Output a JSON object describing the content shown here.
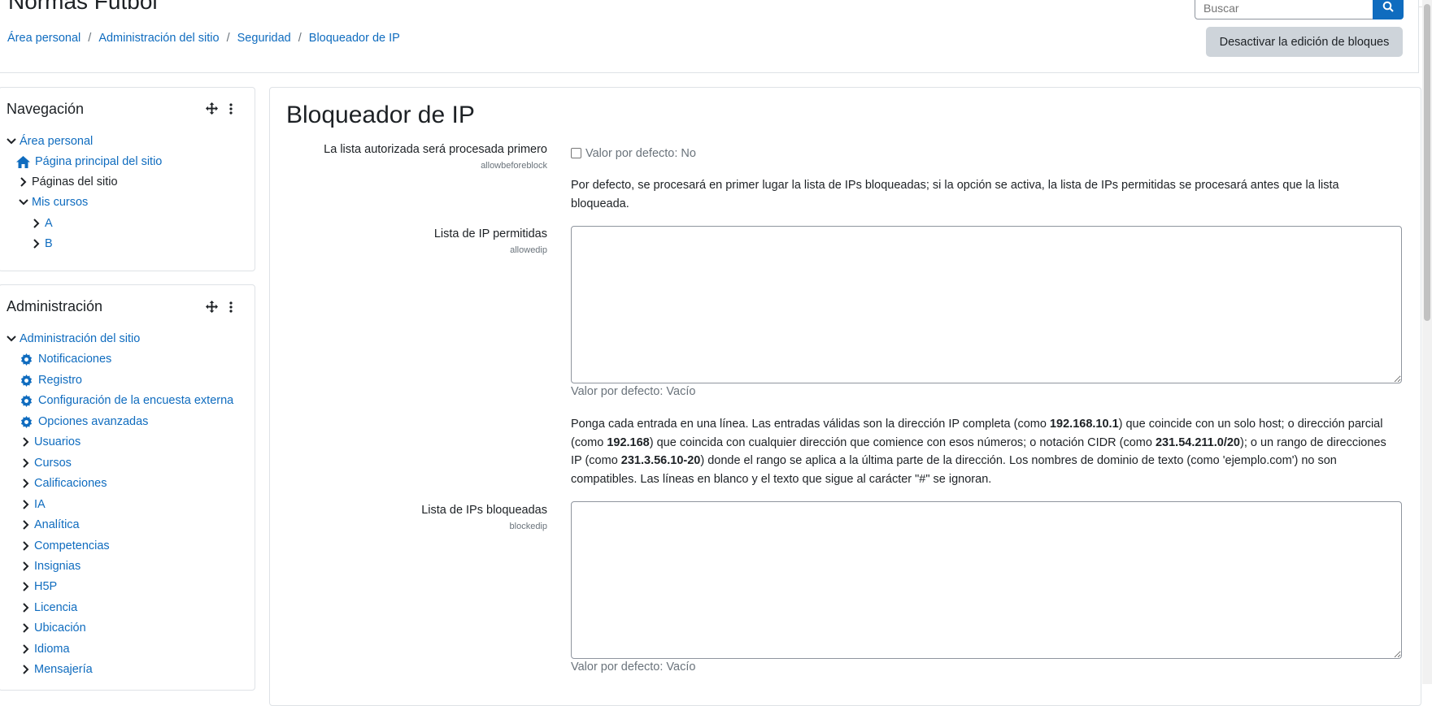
{
  "header": {
    "site_title": "Normas Futbol",
    "search_placeholder": "Buscar",
    "toggle_edit_label": "Desactivar la edición de bloques"
  },
  "breadcrumb": [
    "Área personal",
    "Administración del sitio",
    "Seguridad",
    "Bloqueador de IP"
  ],
  "navigation": {
    "title": "Navegación",
    "items": {
      "area_personal": "Área personal",
      "pagina_principal": "Página principal del sitio",
      "paginas_sitio": "Páginas del sitio",
      "mis_cursos": "Mis cursos",
      "curso_a": "A",
      "curso_b": "B"
    }
  },
  "administration": {
    "title": "Administración",
    "items": {
      "admin_sitio": "Administración del sitio",
      "notificaciones": "Notificaciones",
      "registro": "Registro",
      "encuesta": "Configuración de la encuesta externa",
      "opciones": "Opciones avanzadas",
      "usuarios": "Usuarios",
      "cursos": "Cursos",
      "calificaciones": "Calificaciones",
      "ia": "IA",
      "analitica": "Analítica",
      "competencias": "Competencias",
      "insignias": "Insignias",
      "h5p": "H5P",
      "licencia": "Licencia",
      "ubicacion": "Ubicación",
      "idioma": "Idioma",
      "mensajeria": "Mensajería"
    }
  },
  "main": {
    "page_title": "Bloqueador de IP",
    "allowbeforeblock": {
      "label": "La lista autorizada será procesada primero",
      "key": "allowbeforeblock",
      "checked": false,
      "default": "Valor por defecto: No",
      "description": "Por defecto, se procesará en primer lugar la lista de IPs bloqueadas; si la opción se activa, la lista de IPs permitidas se procesará antes que la lista bloqueada."
    },
    "allowedip": {
      "label": "Lista de IP permitidas",
      "key": "allowedip",
      "value": "",
      "default": "Valor por defecto: Vacío",
      "desc_parts": {
        "p1": "Ponga cada entrada en una línea. Las entradas válidas son la dirección IP completa (como ",
        "b1": "192.168.10.1",
        "p2": ") que coincide con un solo host; o dirección parcial (como ",
        "b2": "192.168",
        "p3": ") que coincida con cualquier dirección que comience con esos números; o notación CIDR (como ",
        "b3": "231.54.211.0/20",
        "p4": "); o un rango de direcciones IP (como ",
        "b4": "231.3.56.10-20",
        "p5": ") donde el rango se aplica a la última parte de la dirección. Los nombres de dominio de texto (como 'ejemplo.com') no son compatibles. Las líneas en blanco y el texto que sigue al carácter \"#\" se ignoran."
      }
    },
    "blockedip": {
      "label": "Lista de IPs bloqueadas",
      "key": "blockedip",
      "value": "",
      "default": "Valor por defecto: Vacío"
    }
  },
  "colors": {
    "link": "#0f6cbf",
    "button_secondary": "#ced4da",
    "border": "#dee2e6",
    "muted_text": "#6a737b"
  }
}
